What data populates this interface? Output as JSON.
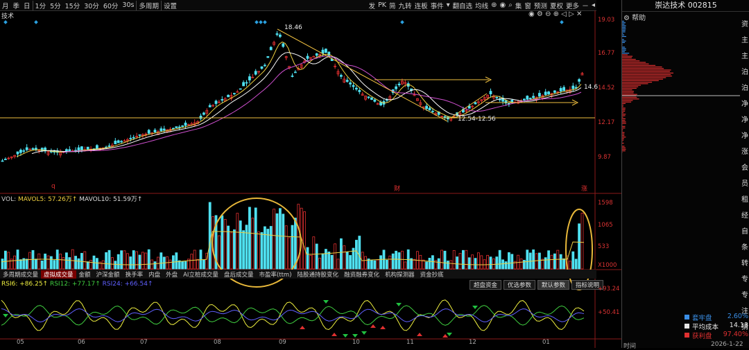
{
  "toolbar": {
    "periods": [
      "月",
      "季",
      "日",
      "1分",
      "5分",
      "15分",
      "30分",
      "60分",
      "30s",
      "多周期",
      "设置"
    ],
    "right_tools": [
      "发",
      "PK",
      "简",
      "九转",
      "连板",
      "事件",
      "翻自选",
      "均线",
      "集",
      "窗",
      "预测",
      "夏权",
      "更多"
    ]
  },
  "kchart": {
    "title": "技术",
    "price_axis": [
      "19.03",
      "16.77",
      "14.52",
      "12.17",
      "9.87"
    ],
    "annotations": {
      "high": "18.46",
      "low": "12.54-12.56",
      "right": "14.6"
    },
    "markers": {
      "q_left": "q",
      "dot_mid": "l",
      "cai": "财",
      "zang": "涨"
    }
  },
  "volume": {
    "label": "VOL:",
    "ma5": "MAVOL5: 57.26万↑",
    "ma10": "MAVOL10: 51.59万↑",
    "axis": [
      "1598",
      "1065",
      "533",
      "X1000"
    ]
  },
  "indicator_tabs": [
    "多周期成交量",
    "虚拟成交量",
    "金额",
    "沪深金额",
    "换手率",
    "内盘",
    "外盘",
    "AI立桩成交量",
    "盘后成交量",
    "市盈率(ttm)",
    "陆股通持股变化",
    "融资融券变化",
    "机构探测器",
    "资金抄底"
  ],
  "indicator_buttons": [
    "超盘资金",
    "优选参数",
    "默认参数",
    "指标说明"
  ],
  "rsi": {
    "rsi6": "RSI6: +86.25↑",
    "rsi12": "RSI12: +77.17↑",
    "rsi24": "RSI24: +66.54↑",
    "axis": [
      "+93.24",
      "+50.41"
    ]
  },
  "months": [
    "05",
    "06",
    "07",
    "08",
    "09",
    "10",
    "11",
    "12",
    "01"
  ],
  "right_panel": {
    "title": "崇达技术 002815",
    "help": "帮助",
    "chip_labels": [
      "套牢盘",
      "平均成本",
      "获利盘"
    ],
    "chip_values": [
      "2.60%",
      "14.13",
      "97.40%"
    ],
    "chip_colors": [
      "#3a8ee6",
      "#e6e6e6",
      "#e03030"
    ],
    "footer_left": "时间",
    "footer_right": "2026-1-22",
    "side_glyphs": [
      "资",
      "主",
      "主",
      "泊",
      "泊",
      "净",
      "净",
      "净",
      "涨",
      "会",
      "员",
      "租",
      "经",
      "自",
      "条",
      "转",
      "专",
      "专",
      "注",
      "猜"
    ]
  },
  "colors": {
    "up": "#e03030",
    "down": "#4fe0f0",
    "ma": "#f0d040",
    "annot": "#f0c040",
    "circle": "#e8b83a"
  }
}
